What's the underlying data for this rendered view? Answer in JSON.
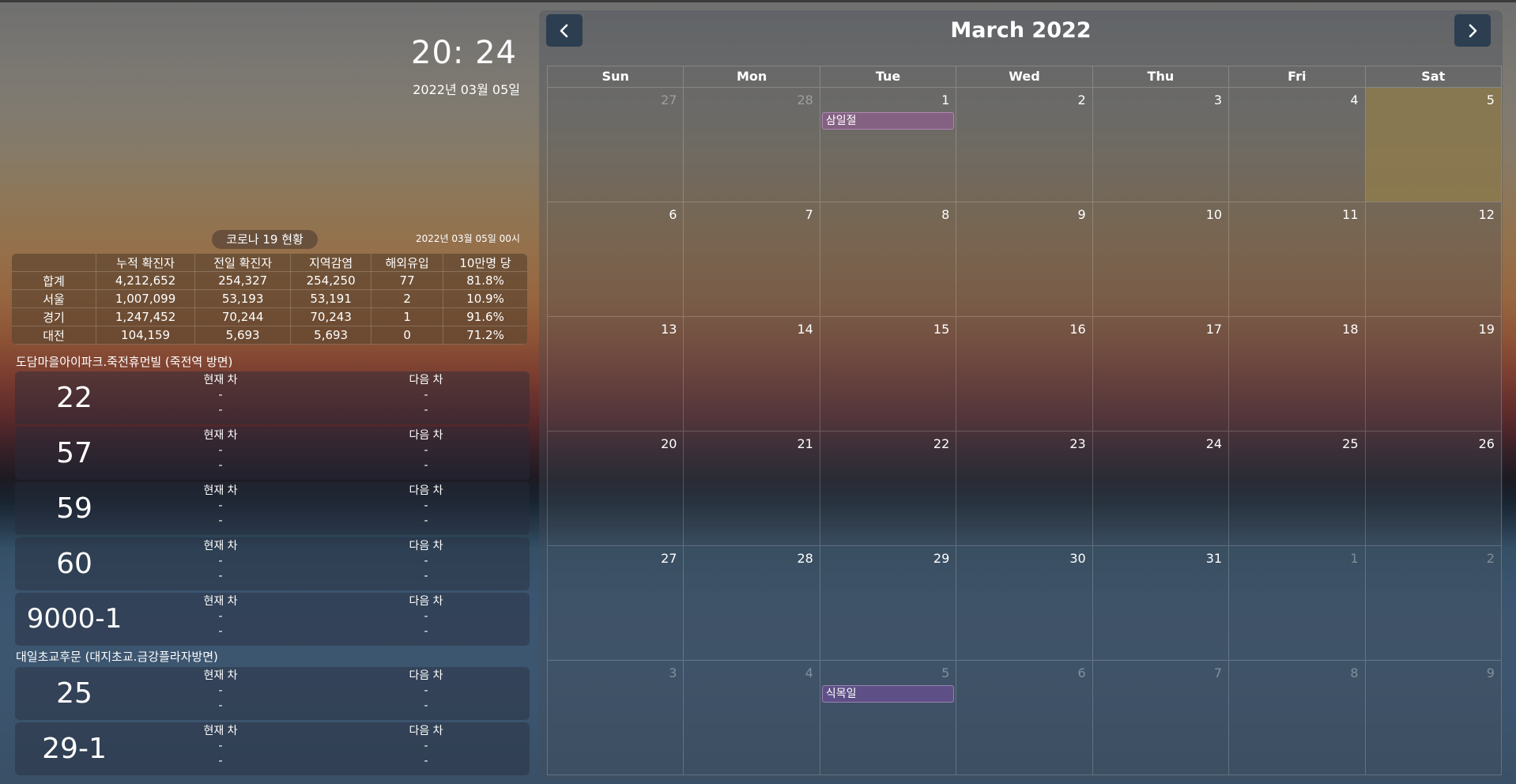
{
  "clock": {
    "time": "20: 24",
    "date": "2022년 03월 05일"
  },
  "covid": {
    "title": "코로나 19 현황",
    "updated": "2022년 03월 05일 00시",
    "headers": [
      "",
      "누적 확진자",
      "전일 확진자",
      "지역감염",
      "해외유입",
      "10만명 당"
    ],
    "rows": [
      [
        "합계",
        "4,212,652",
        "254,327",
        "254,250",
        "77",
        "81.8%"
      ],
      [
        "서울",
        "1,007,099",
        "53,193",
        "53,191",
        "2",
        "10.9%"
      ],
      [
        "경기",
        "1,247,452",
        "70,244",
        "70,243",
        "1",
        "91.6%"
      ],
      [
        "대전",
        "104,159",
        "5,693",
        "5,693",
        "0",
        "71.2%"
      ]
    ]
  },
  "bus": {
    "cur_label": "현재 차",
    "next_label": "다음 차",
    "dash": "-",
    "stops": [
      {
        "name": "도담마을아이파크.죽전휴먼빌 (죽전역 방면)",
        "routes": [
          "22",
          "57",
          "59",
          "60",
          "9000-1"
        ]
      },
      {
        "name": "대일초교후문 (대지초교.금강플라자방면)",
        "routes": [
          "25",
          "29-1"
        ]
      }
    ]
  },
  "calendar": {
    "title": "March 2022",
    "prev_icon": "chevron-left-icon",
    "next_icon": "chevron-right-icon",
    "dow": [
      "Sun",
      "Mon",
      "Tue",
      "Wed",
      "Thu",
      "Fri",
      "Sat"
    ],
    "weeks": [
      [
        {
          "d": "27",
          "o": true
        },
        {
          "d": "28",
          "o": true
        },
        {
          "d": "1",
          "e": "삼일절"
        },
        {
          "d": "2"
        },
        {
          "d": "3"
        },
        {
          "d": "4"
        },
        {
          "d": "5",
          "t": true
        }
      ],
      [
        {
          "d": "6"
        },
        {
          "d": "7"
        },
        {
          "d": "8"
        },
        {
          "d": "9"
        },
        {
          "d": "10"
        },
        {
          "d": "11"
        },
        {
          "d": "12"
        }
      ],
      [
        {
          "d": "13"
        },
        {
          "d": "14"
        },
        {
          "d": "15"
        },
        {
          "d": "16"
        },
        {
          "d": "17"
        },
        {
          "d": "18"
        },
        {
          "d": "19"
        }
      ],
      [
        {
          "d": "20"
        },
        {
          "d": "21"
        },
        {
          "d": "22"
        },
        {
          "d": "23"
        },
        {
          "d": "24"
        },
        {
          "d": "25"
        },
        {
          "d": "26"
        }
      ],
      [
        {
          "d": "27"
        },
        {
          "d": "28"
        },
        {
          "d": "29"
        },
        {
          "d": "30"
        },
        {
          "d": "31"
        },
        {
          "d": "1",
          "o": true
        },
        {
          "d": "2",
          "o": true
        }
      ],
      [
        {
          "d": "3",
          "o": true
        },
        {
          "d": "4",
          "o": true
        },
        {
          "d": "5",
          "o": true,
          "e": "식목일",
          "alt": true
        },
        {
          "d": "6",
          "o": true
        },
        {
          "d": "7",
          "o": true
        },
        {
          "d": "8",
          "o": true
        },
        {
          "d": "9",
          "o": true
        }
      ]
    ]
  }
}
